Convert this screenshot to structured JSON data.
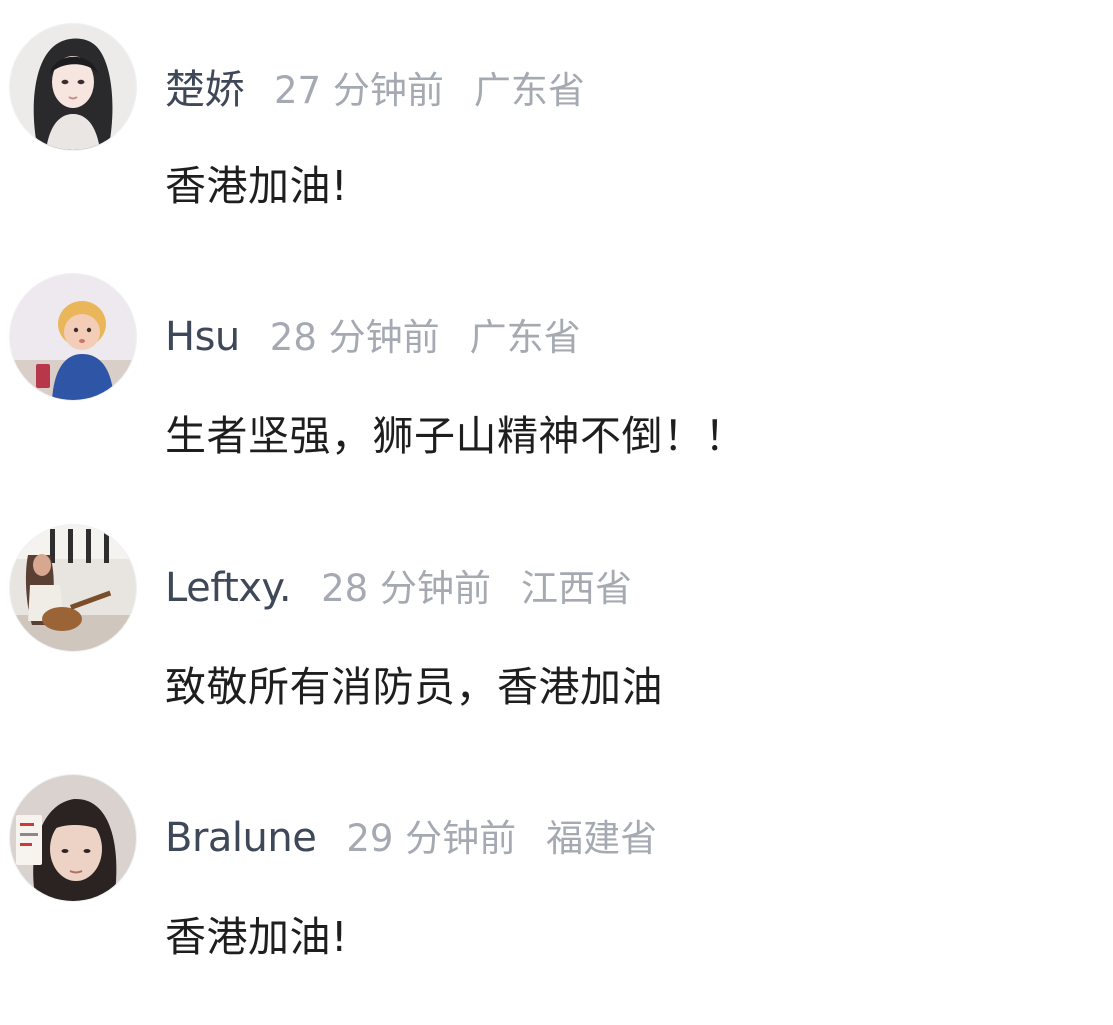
{
  "comments": [
    {
      "avatar_icon": "girl-portrait-avatar",
      "username": "楚娇",
      "time": "27 分钟前",
      "location": "广东省",
      "text": "香港加油!"
    },
    {
      "avatar_icon": "toddler-photo-avatar",
      "username": "Hsu",
      "time": "28 分钟前",
      "location": "广东省",
      "text": "生者坚强，狮子山精神不倒！！"
    },
    {
      "avatar_icon": "guitar-player-avatar",
      "username": "Leftxy.",
      "time": "28 分钟前",
      "location": "江西省",
      "text": "致敬所有消防员，香港加油"
    },
    {
      "avatar_icon": "woman-selfie-avatar",
      "username": "Bralune",
      "time": "29 分钟前",
      "location": "福建省",
      "text": "香港加油!"
    }
  ],
  "colors": {
    "username": "#3f4858",
    "meta": "#a4a9b2",
    "text": "#1e1e1e",
    "background": "#ffffff"
  }
}
